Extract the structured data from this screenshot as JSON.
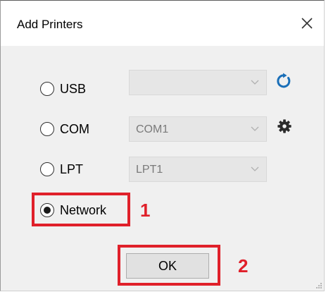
{
  "window": {
    "title": "Add Printers"
  },
  "ports": [
    {
      "label": "USB",
      "selected": false,
      "combo_value": ""
    },
    {
      "label": "COM",
      "selected": false,
      "combo_value": "COM1"
    },
    {
      "label": "LPT",
      "selected": false,
      "combo_value": "LPT1"
    },
    {
      "label": "Network",
      "selected": true
    }
  ],
  "buttons": {
    "ok_label": "OK"
  },
  "annotations": [
    {
      "number": "1"
    },
    {
      "number": "2"
    }
  ],
  "icons": {
    "close": "close-icon",
    "refresh": "refresh-icon",
    "settings": "gear-icon",
    "chevron": "chevron-down-icon"
  },
  "colors": {
    "annotation": "#e0202a",
    "refresh_icon": "#1a6fb8",
    "dialog_bg": "#f0f0f0"
  }
}
